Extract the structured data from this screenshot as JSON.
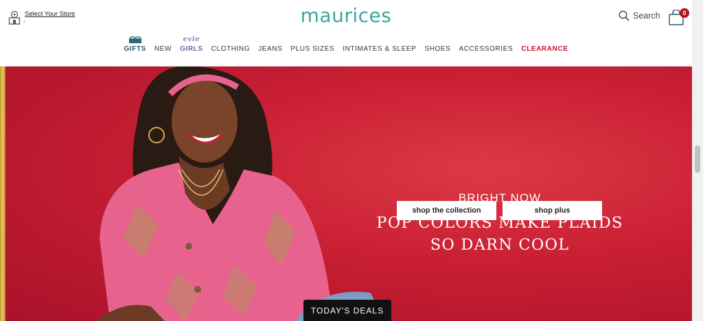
{
  "header": {
    "store_label": "Select Your Store",
    "store_status": "•",
    "logo": "maurices",
    "search_label": "Search",
    "cart_count": "0"
  },
  "nav": {
    "items": [
      {
        "label": "GIFTS"
      },
      {
        "label": "NEW"
      },
      {
        "label": "GIRLS",
        "brand_tag": "evie"
      },
      {
        "label": "CLOTHING"
      },
      {
        "label": "JEANS"
      },
      {
        "label": "PLUS SIZES"
      },
      {
        "label": "INTIMATES & SLEEP"
      },
      {
        "label": "SHOES"
      },
      {
        "label": "ACCESSORIES"
      },
      {
        "label": "CLEARANCE"
      }
    ]
  },
  "hero": {
    "eyebrow": "BRIGHT NOW",
    "headline_line1": "POP COLORS MAKE PLAIDS",
    "headline_line2": "SO DARN COOL",
    "button_collection": "shop the collection",
    "button_plus": "shop plus",
    "background_color": "#c81e33"
  },
  "deals": {
    "label": "TODAY'S DEALS"
  },
  "colors": {
    "brand_teal": "#3ea59b",
    "clearance_red": "#c8102e",
    "girls_purple": "#7b5ea7",
    "badge_red": "#b5121b"
  }
}
